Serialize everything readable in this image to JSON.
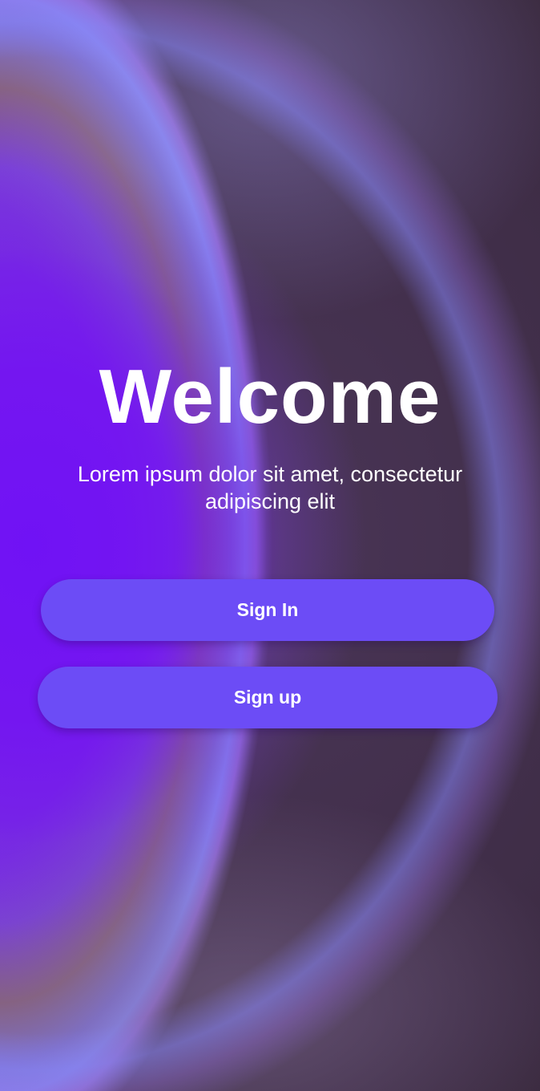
{
  "welcome": {
    "title": "Welcome",
    "subtitle": "Lorem ipsum dolor sit amet, consectetur adipiscing elit"
  },
  "actions": {
    "sign_in_label": "Sign In",
    "sign_up_label": "Sign up"
  },
  "colors": {
    "button": "#6c4cf6",
    "background_primary": "#7414f5",
    "background_dark": "#3b2a3c",
    "text": "#ffffff"
  }
}
